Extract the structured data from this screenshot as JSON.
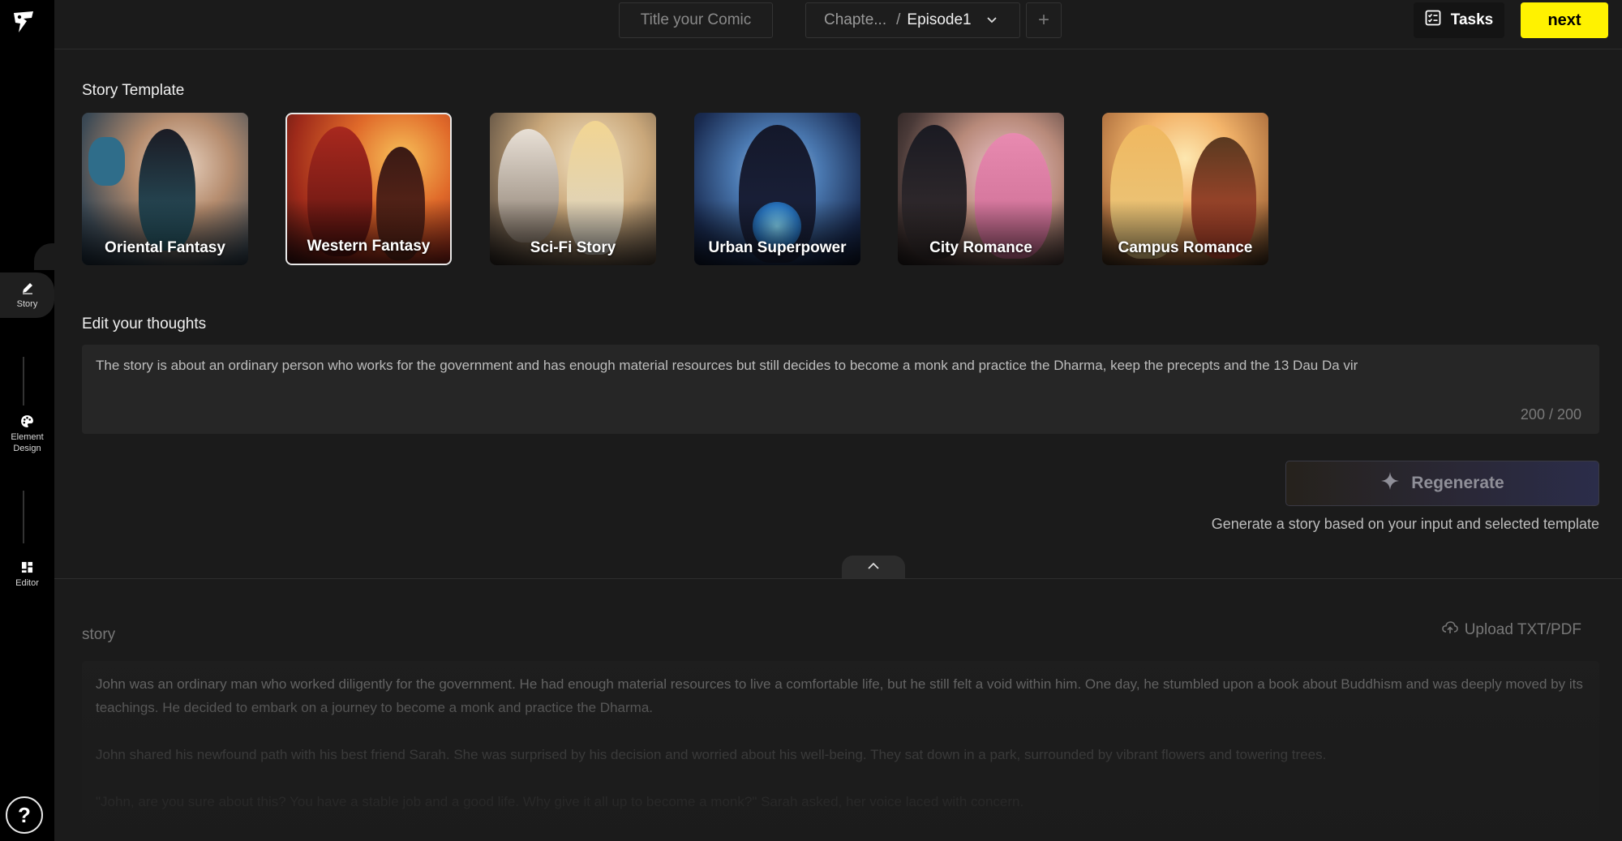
{
  "topbar": {
    "title_placeholder": "Title your Comic",
    "chapter": "Chapte...",
    "separator": "/",
    "episode": "Episode1",
    "add_symbol": "+",
    "tasks_label": "Tasks",
    "next_label": "next"
  },
  "sidebar": {
    "items": [
      {
        "label": "Story"
      },
      {
        "label": "Element Design"
      },
      {
        "label": "Editor"
      }
    ],
    "help_symbol": "?"
  },
  "template": {
    "heading": "Story Template",
    "cards": [
      {
        "label": "Oriental Fantasy"
      },
      {
        "label": "Western Fantasy"
      },
      {
        "label": "Sci-Fi Story"
      },
      {
        "label": "Urban Superpower"
      },
      {
        "label": "City Romance"
      },
      {
        "label": "Campus Romance"
      }
    ],
    "selected_index": 1
  },
  "thoughts": {
    "heading": "Edit your thoughts",
    "value": "The story is about an ordinary person who works for the government and has enough material resources but still decides to become a monk and practice the Dharma, keep the precepts and the 13 Dau Da vir",
    "counter": "200 / 200"
  },
  "regenerate": {
    "label": "Regenerate",
    "hint": "Generate a story based on your input and selected template"
  },
  "story": {
    "label": "story",
    "upload_label": "Upload TXT/PDF",
    "paragraphs": [
      "John was an ordinary man who worked diligently for the government. He had enough material resources to live a comfortable life, but he still felt a void within him. One day, he stumbled upon a book about Buddhism and was deeply moved by its teachings. He decided to embark on a journey to become a monk and practice the Dharma.",
      "John shared his newfound path with his best friend Sarah. She was surprised by his decision and worried about his well-being. They sat down in a park, surrounded by vibrant flowers and towering trees.",
      "\"John, are you sure about this? You have a stable job and a good life. Why give it all up to become a monk?\" Sarah asked, her voice laced with concern."
    ]
  },
  "colors": {
    "accent": "#fff200",
    "background": "#1b1b1b",
    "rail": "#000000"
  }
}
